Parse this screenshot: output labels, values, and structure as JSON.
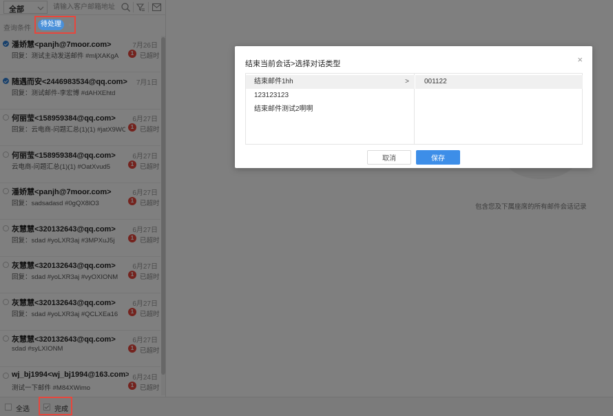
{
  "toolbar": {
    "scope_label": "全部",
    "search_placeholder": "请输入客户邮箱地址"
  },
  "filter": {
    "label": "查询条件",
    "chip_label": "待处理",
    "chip_close": "×"
  },
  "list": {
    "items": [
      {
        "from": "潘娇慧<panjh@7moor.com>",
        "date": "7月26日",
        "subject": "回复：测试主动发送邮件 #mljXAKgA",
        "badge": "1",
        "status": "已超时",
        "selected": true
      },
      {
        "from": "随遇而安<2446983534@qq.com>",
        "date": "7月1日",
        "subject": "回复：测试邮件-李宏博 #dAHXEhtd",
        "badge": "",
        "status": "",
        "selected": true
      },
      {
        "from": "何丽莹<158959384@qq.com>",
        "date": "6月27日",
        "subject": "回复：云电商-问题汇总(1)(1) #jatX9WC…",
        "badge": "1",
        "status": "已超时",
        "selected": false
      },
      {
        "from": "何丽莹<158959384@qq.com>",
        "date": "6月27日",
        "subject": "云电商-问题汇总(1)(1) #OatXvud5",
        "badge": "1",
        "status": "已超时",
        "selected": false
      },
      {
        "from": "潘娇慧<panjh@7moor.com>",
        "date": "6月27日",
        "subject": "回复：sadsadasd #0gQX8lO3",
        "badge": "1",
        "status": "已超时",
        "selected": false
      },
      {
        "from": "灰慧慧<320132643@qq.com>",
        "date": "6月27日",
        "subject": "回复：sdad #yoLXR3aj #3MPXuJ5j",
        "badge": "1",
        "status": "已超时",
        "selected": false
      },
      {
        "from": "灰慧慧<320132643@qq.com>",
        "date": "6月27日",
        "subject": "回复：sdad #yoLXR3aj #vyOXIONM",
        "badge": "1",
        "status": "已超时",
        "selected": false
      },
      {
        "from": "灰慧慧<320132643@qq.com>",
        "date": "6月27日",
        "subject": "回复：sdad #yoLXR3aj #QCLXEa16",
        "badge": "1",
        "status": "已超时",
        "selected": false
      },
      {
        "from": "灰慧慧<320132643@qq.com>",
        "date": "6月27日",
        "subject": "sdad #syLXIONM",
        "badge": "1",
        "status": "已超时",
        "selected": false
      },
      {
        "from": "wj_bj1994<wj_bj1994@163.com>",
        "date": "6月24日",
        "subject": "测试一下邮件 #M84XWimo",
        "badge": "1",
        "status": "已超时",
        "selected": false
      }
    ]
  },
  "bottombar": {
    "select_all": "全选",
    "done": "完成"
  },
  "right_panel": {
    "empty_text": "包含您及下属座席的所有邮件会话记录"
  },
  "modal": {
    "title": "结束当前会话>选择对话类型",
    "close": "×",
    "left_options": [
      {
        "label": "结束邮件1hh",
        "active": true,
        "arrow": ">"
      },
      {
        "label": "123123123",
        "active": false,
        "arrow": ""
      },
      {
        "label": "结束邮件测试2啊啊",
        "active": false,
        "arrow": ""
      }
    ],
    "right_options": [
      {
        "label": "001122"
      }
    ],
    "cancel_label": "取消",
    "save_label": "保存"
  },
  "colors": {
    "accent": "#3d8ee8",
    "highlight": "#e8463c",
    "badge": "#e8463c",
    "overlay": "rgba(0,0,0,0.5)"
  }
}
